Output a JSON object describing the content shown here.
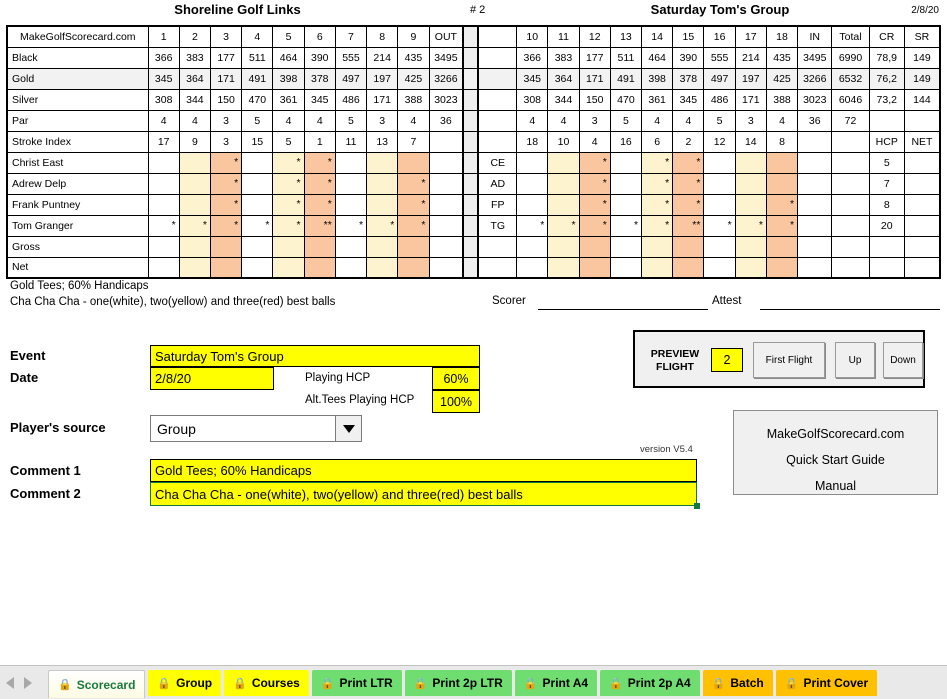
{
  "header": {
    "course": "Shoreline Golf Links",
    "card_number": "# 2",
    "event": "Saturday Tom's Group",
    "date": "2/8/20"
  },
  "scorecard": {
    "brand": "MakeGolfScorecard.com",
    "front_holes": [
      "1",
      "2",
      "3",
      "4",
      "5",
      "6",
      "7",
      "8",
      "9"
    ],
    "back_holes": [
      "10",
      "11",
      "12",
      "13",
      "14",
      "15",
      "16",
      "17",
      "18"
    ],
    "out_label": "OUT",
    "in_label": "IN",
    "total_label": "Total",
    "cr_label": "CR",
    "sr_label": "SR",
    "hcp_label": "HCP",
    "net_label": "NET",
    "tees": [
      {
        "name": "Black",
        "front": [
          "366",
          "383",
          "177",
          "511",
          "464",
          "390",
          "555",
          "214",
          "435"
        ],
        "out": "3495",
        "back": [
          "366",
          "383",
          "177",
          "511",
          "464",
          "390",
          "555",
          "214",
          "435"
        ],
        "in": "3495",
        "total": "6990",
        "cr": "78,9",
        "sr": "149"
      },
      {
        "name": "Gold",
        "front": [
          "345",
          "364",
          "171",
          "491",
          "398",
          "378",
          "497",
          "197",
          "425"
        ],
        "out": "3266",
        "back": [
          "345",
          "364",
          "171",
          "491",
          "398",
          "378",
          "497",
          "197",
          "425"
        ],
        "in": "3266",
        "total": "6532",
        "cr": "76,2",
        "sr": "149"
      },
      {
        "name": "Silver",
        "front": [
          "308",
          "344",
          "150",
          "470",
          "361",
          "345",
          "486",
          "171",
          "388"
        ],
        "out": "3023",
        "back": [
          "308",
          "344",
          "150",
          "470",
          "361",
          "345",
          "486",
          "171",
          "388"
        ],
        "in": "3023",
        "total": "6046",
        "cr": "73,2",
        "sr": "144"
      }
    ],
    "par": {
      "name": "Par",
      "front": [
        "4",
        "4",
        "3",
        "5",
        "4",
        "4",
        "5",
        "3",
        "4"
      ],
      "out": "36",
      "back": [
        "4",
        "4",
        "3",
        "5",
        "4",
        "4",
        "5",
        "3",
        "4"
      ],
      "in": "36",
      "total": "72",
      "cr": "",
      "sr": ""
    },
    "stroke_index": {
      "name": "Stroke Index",
      "front": [
        "17",
        "9",
        "3",
        "15",
        "5",
        "1",
        "11",
        "13",
        "7"
      ],
      "out": "",
      "back": [
        "18",
        "10",
        "4",
        "16",
        "6",
        "2",
        "12",
        "14",
        "8"
      ],
      "in": "",
      "total": "",
      "cr": "HCP",
      "sr": "NET"
    },
    "players": [
      {
        "name": "Christ East",
        "initials": "CE",
        "front": [
          "",
          "",
          "*",
          "",
          "*",
          "*",
          "",
          "",
          ""
        ],
        "out": "",
        "back": [
          "",
          "",
          "*",
          "",
          "*",
          "*",
          "",
          "",
          ""
        ],
        "in": "",
        "total": "",
        "hcp": "5",
        "net": ""
      },
      {
        "name": "Adrew Delp",
        "initials": "AD",
        "front": [
          "",
          "",
          "*",
          "",
          "*",
          "*",
          "",
          "",
          "*"
        ],
        "out": "",
        "back": [
          "",
          "",
          "*",
          "",
          "*",
          "*",
          "",
          "",
          ""
        ],
        "in": "",
        "total": "",
        "hcp": "7",
        "net": ""
      },
      {
        "name": "Frank Puntney",
        "initials": "FP",
        "front": [
          "",
          "",
          "*",
          "",
          "*",
          "*",
          "",
          "",
          "*"
        ],
        "out": "",
        "back": [
          "",
          "",
          "*",
          "",
          "*",
          "*",
          "",
          "",
          "*"
        ],
        "in": "",
        "total": "",
        "hcp": "8",
        "net": ""
      },
      {
        "name": "Tom Granger",
        "initials": "TG",
        "front": [
          "*",
          "*",
          "*",
          "*",
          "*",
          "**",
          "*",
          "*",
          "*"
        ],
        "out": "",
        "back": [
          "*",
          "*",
          "*",
          "*",
          "*",
          "**",
          "*",
          "*",
          "*"
        ],
        "in": "",
        "total": "",
        "hcp": "20",
        "net": ""
      }
    ],
    "summary_rows": [
      {
        "name": "Gross"
      },
      {
        "name": "Net"
      }
    ],
    "colors": {
      "white_ball": "#ffffff",
      "yellow_ball": "#fdf3cf",
      "red_ball": "#fac6a0",
      "tee_row_highlight": "#f2f2f2"
    }
  },
  "notes": {
    "line1": "Gold Tees; 60% Handicaps",
    "line2": "Cha Cha Cha - one(white), two(yellow) and three(red) best balls"
  },
  "signatures": {
    "scorer_label": "Scorer",
    "attest_label": "Attest"
  },
  "form": {
    "event_label": "Event",
    "event_value": "Saturday Tom's Group",
    "date_label": "Date",
    "date_value": "2/8/20",
    "playing_hcp_label": "Playing HCP",
    "playing_hcp_value": "60%",
    "alt_tees_label": "Alt.Tees Playing HCP",
    "alt_tees_value": "100%",
    "player_source_label": "Player's source",
    "player_source_value": "Group",
    "comment1_label": "Comment 1",
    "comment1_value": "Gold Tees; 60% Handicaps",
    "comment2_label": "Comment 2",
    "comment2_value": "Cha Cha Cha - one(white), two(yellow) and three(red) best balls",
    "version": "version V5.4"
  },
  "preview_flight": {
    "label_line1": "PREVIEW",
    "label_line2": "FLIGHT",
    "value": "2",
    "first_flight_button": "First Flight",
    "up_button": "Up",
    "down_button": "Down"
  },
  "links_panel": {
    "line1": "MakeGolfScorecard.com",
    "line2": "Quick Start Guide",
    "line3": "Manual"
  },
  "tabs": [
    {
      "label": "Scorecard",
      "style": "active",
      "locked": true
    },
    {
      "label": "Group",
      "style": "yellow",
      "locked": true
    },
    {
      "label": "Courses",
      "style": "yellow",
      "locked": true
    },
    {
      "label": "Print LTR",
      "style": "green",
      "locked": true
    },
    {
      "label": "Print 2p LTR",
      "style": "green",
      "locked": true
    },
    {
      "label": "Print A4",
      "style": "green",
      "locked": true
    },
    {
      "label": "Print 2p A4",
      "style": "green",
      "locked": true
    },
    {
      "label": "Batch",
      "style": "orange",
      "locked": true
    },
    {
      "label": "Print Cover",
      "style": "orange",
      "locked": true
    }
  ],
  "icons": {
    "lock": "🔒",
    "prev_arrow": "prev-arrow-icon",
    "next_arrow": "next-arrow-icon",
    "dropdown_chevron": "chevron-down-icon"
  }
}
